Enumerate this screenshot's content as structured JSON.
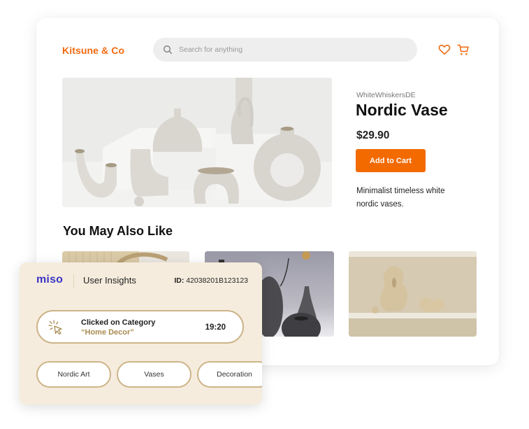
{
  "header": {
    "brand": "Kitsune & Co",
    "search_placeholder": "Search for anything",
    "search_value": "",
    "icons": [
      "heart-icon",
      "cart-icon"
    ]
  },
  "product": {
    "image": "nordic-vases-photo",
    "seller": "WhiteWhiskersDE",
    "title": "Nordic Vase",
    "price": "$29.90",
    "add_to_cart_label": "Add to Cart",
    "description": "Minimalist timeless white nordic vases."
  },
  "recommendations": {
    "title": "You May Also Like",
    "items": [
      {
        "image": "beige-vase-with-dried-grass-photo"
      },
      {
        "image": "dark-grey-vases-photo"
      },
      {
        "image": "beige-sculptural-vases-on-shelf-photo"
      }
    ]
  },
  "insights": {
    "logo": "miso",
    "title": "User Insights",
    "id_label": "ID:",
    "id_value": "42038201B123123",
    "event": {
      "icon": "click-cursor-icon",
      "action": "Clicked on Category",
      "category": "“Home Decor”",
      "time": "19:20"
    },
    "tags": [
      "Nordic Art",
      "Vases",
      "Decoration"
    ]
  },
  "colors": {
    "brand_orange": "#f26a00",
    "miso_blue": "#3a34c4",
    "insight_bg": "#f5ecdd",
    "insight_border": "#cdb489"
  }
}
